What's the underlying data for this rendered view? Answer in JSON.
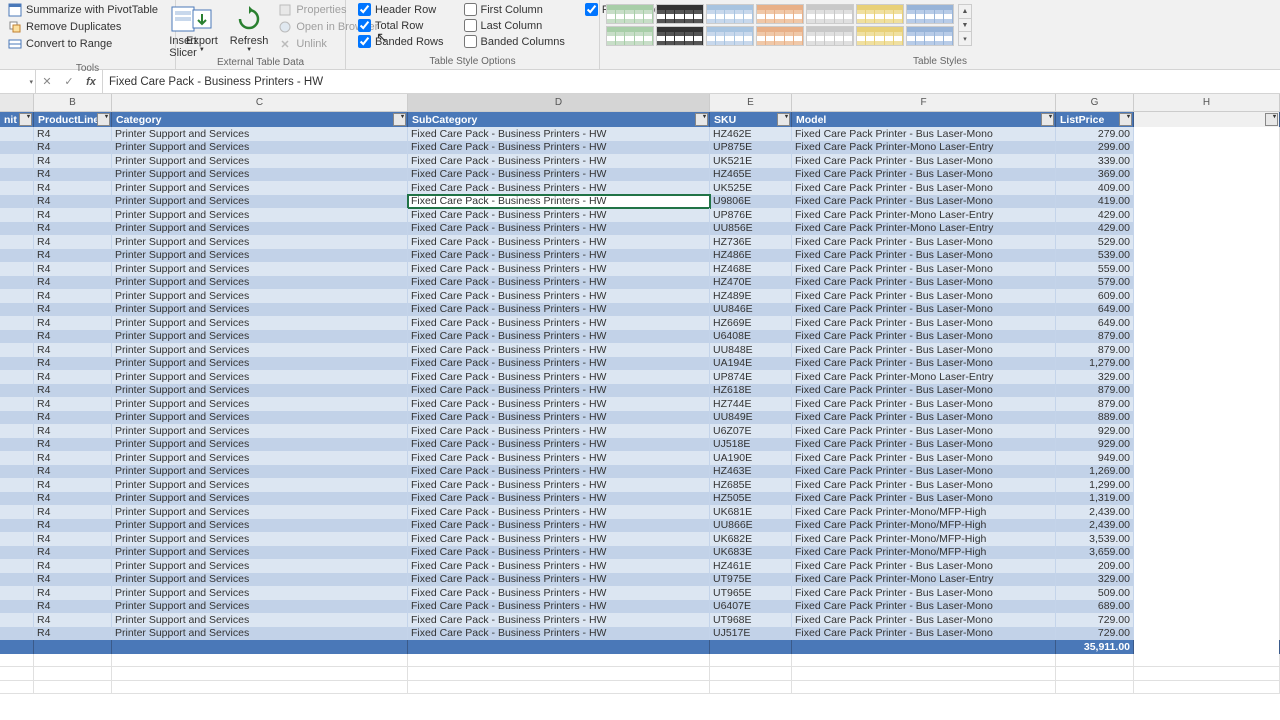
{
  "ribbon": {
    "tools": {
      "title": "Tools",
      "pivot": "Summarize with PivotTable",
      "dup": "Remove Duplicates",
      "range": "Convert to Range",
      "slicer": "Insert\nSlicer"
    },
    "ext": {
      "title": "External Table Data",
      "export": "Export",
      "refresh": "Refresh",
      "props": "Properties",
      "browser": "Open in Browser",
      "unlink": "Unlink"
    },
    "opts": {
      "title": "Table Style Options",
      "header": "Header Row",
      "total": "Total Row",
      "banded_r": "Banded Rows",
      "first": "First Column",
      "last": "Last Column",
      "banded_c": "Banded Columns",
      "filter": "Filter Button"
    },
    "styles": {
      "title": "Table Styles"
    }
  },
  "formula_bar": {
    "value": "Fixed Care Pack - Business Printers - HW"
  },
  "col_letters": [
    "B",
    "C",
    "D",
    "E",
    "F",
    "G",
    "H"
  ],
  "headers": {
    "unit": "nit",
    "pl": "ProductLine",
    "cat": "Category",
    "sub": "SubCategory",
    "sku": "SKU",
    "model": "Model",
    "price": "ListPrice"
  },
  "const_vals": {
    "pl": "R4",
    "cat": "Printer Support and Services",
    "sub": "Fixed Care Pack - Business Printers - HW"
  },
  "rows": [
    {
      "sku": "HZ462E",
      "model": "Fixed Care Pack Printer - Bus Laser-Mono",
      "price": "279.00"
    },
    {
      "sku": "UP875E",
      "model": "Fixed Care Pack Printer-Mono Laser-Entry",
      "price": "299.00"
    },
    {
      "sku": "UK521E",
      "model": "Fixed Care Pack Printer - Bus Laser-Mono",
      "price": "339.00"
    },
    {
      "sku": "HZ465E",
      "model": "Fixed Care Pack Printer - Bus Laser-Mono",
      "price": "369.00"
    },
    {
      "sku": "UK525E",
      "model": "Fixed Care Pack Printer - Bus Laser-Mono",
      "price": "409.00"
    },
    {
      "sku": "U9806E",
      "model": "Fixed Care Pack Printer - Bus Laser-Mono",
      "price": "419.00",
      "sel": true
    },
    {
      "sku": "UP876E",
      "model": "Fixed Care Pack Printer-Mono Laser-Entry",
      "price": "429.00"
    },
    {
      "sku": "UU856E",
      "model": "Fixed Care Pack Printer-Mono Laser-Entry",
      "price": "429.00"
    },
    {
      "sku": "HZ736E",
      "model": "Fixed Care Pack Printer - Bus Laser-Mono",
      "price": "529.00"
    },
    {
      "sku": "HZ486E",
      "model": "Fixed Care Pack Printer - Bus Laser-Mono",
      "price": "539.00"
    },
    {
      "sku": "HZ468E",
      "model": "Fixed Care Pack Printer - Bus Laser-Mono",
      "price": "559.00"
    },
    {
      "sku": "HZ470E",
      "model": "Fixed Care Pack Printer - Bus Laser-Mono",
      "price": "579.00"
    },
    {
      "sku": "HZ489E",
      "model": "Fixed Care Pack Printer - Bus Laser-Mono",
      "price": "609.00"
    },
    {
      "sku": "UU846E",
      "model": "Fixed Care Pack Printer - Bus Laser-Mono",
      "price": "649.00"
    },
    {
      "sku": "HZ669E",
      "model": "Fixed Care Pack Printer - Bus Laser-Mono",
      "price": "649.00"
    },
    {
      "sku": "U6408E",
      "model": "Fixed Care Pack Printer - Bus Laser-Mono",
      "price": "879.00"
    },
    {
      "sku": "UU848E",
      "model": "Fixed Care Pack Printer - Bus Laser-Mono",
      "price": "879.00"
    },
    {
      "sku": "UA194E",
      "model": "Fixed Care Pack Printer - Bus Laser-Mono",
      "price": "1,279.00"
    },
    {
      "sku": "UP874E",
      "model": "Fixed Care Pack Printer-Mono Laser-Entry",
      "price": "329.00"
    },
    {
      "sku": "HZ618E",
      "model": "Fixed Care Pack Printer - Bus Laser-Mono",
      "price": "879.00"
    },
    {
      "sku": "HZ744E",
      "model": "Fixed Care Pack Printer - Bus Laser-Mono",
      "price": "879.00"
    },
    {
      "sku": "UU849E",
      "model": "Fixed Care Pack Printer - Bus Laser-Mono",
      "price": "889.00"
    },
    {
      "sku": "U6Z07E",
      "model": "Fixed Care Pack Printer - Bus Laser-Mono",
      "price": "929.00"
    },
    {
      "sku": "UJ518E",
      "model": "Fixed Care Pack Printer - Bus Laser-Mono",
      "price": "929.00"
    },
    {
      "sku": "UA190E",
      "model": "Fixed Care Pack Printer - Bus Laser-Mono",
      "price": "949.00"
    },
    {
      "sku": "HZ463E",
      "model": "Fixed Care Pack Printer - Bus Laser-Mono",
      "price": "1,269.00"
    },
    {
      "sku": "HZ685E",
      "model": "Fixed Care Pack Printer - Bus Laser-Mono",
      "price": "1,299.00"
    },
    {
      "sku": "HZ505E",
      "model": "Fixed Care Pack Printer - Bus Laser-Mono",
      "price": "1,319.00"
    },
    {
      "sku": "UK681E",
      "model": "Fixed Care Pack Printer-Mono/MFP-High",
      "price": "2,439.00"
    },
    {
      "sku": "UU866E",
      "model": "Fixed Care Pack Printer-Mono/MFP-High",
      "price": "2,439.00"
    },
    {
      "sku": "UK682E",
      "model": "Fixed Care Pack Printer-Mono/MFP-High",
      "price": "3,539.00"
    },
    {
      "sku": "UK683E",
      "model": "Fixed Care Pack Printer-Mono/MFP-High",
      "price": "3,659.00"
    },
    {
      "sku": "HZ461E",
      "model": "Fixed Care Pack Printer - Bus Laser-Mono",
      "price": "209.00"
    },
    {
      "sku": "UT975E",
      "model": "Fixed Care Pack Printer-Mono Laser-Entry",
      "price": "329.00"
    },
    {
      "sku": "UT965E",
      "model": "Fixed Care Pack Printer - Bus Laser-Mono",
      "price": "509.00"
    },
    {
      "sku": "U6407E",
      "model": "Fixed Care Pack Printer - Bus Laser-Mono",
      "price": "689.00"
    },
    {
      "sku": "UT968E",
      "model": "Fixed Care Pack Printer - Bus Laser-Mono",
      "price": "729.00"
    },
    {
      "sku": "UJ517E",
      "model": "Fixed Care Pack Printer - Bus Laser-Mono",
      "price": "729.00"
    }
  ],
  "total": "35,911.00",
  "style_colors": [
    [
      "#c8dec8",
      "#a8cea8"
    ],
    [
      "#555",
      "#333"
    ],
    [
      "#c8d8ec",
      "#a8c4e0"
    ],
    [
      "#f0c8a8",
      "#e8b088"
    ],
    [
      "#e0e0e0",
      "#c8c8c8"
    ],
    [
      "#f0e0a0",
      "#e8d078"
    ],
    [
      "#b8cce8",
      "#98b4d8"
    ]
  ]
}
